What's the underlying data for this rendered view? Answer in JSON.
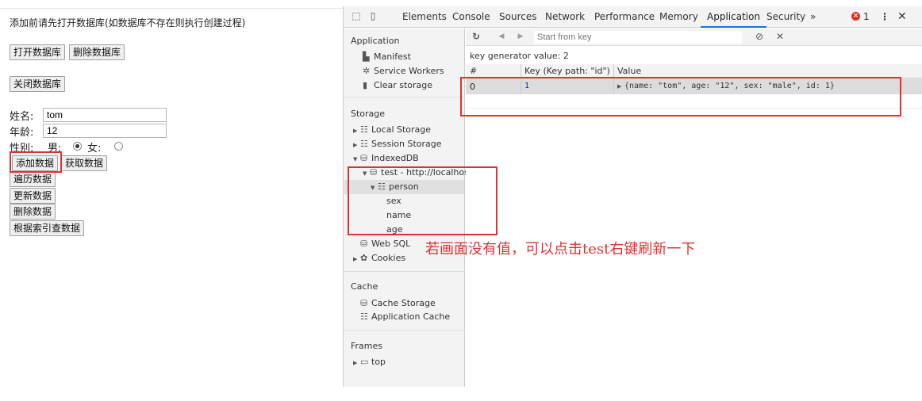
{
  "page": {
    "intro": "添加前请先打开数据库(如数据库不存在则执行创建过程)",
    "buttons": {
      "open_db": "打开数据库",
      "delete_db": "删除数据库",
      "close_db": "关闭数据库",
      "add": "添加数据",
      "get": "获取数据",
      "iterate": "遍历数据",
      "update": "更新数据",
      "delete": "删除数据",
      "query_index": "根据索引查数据"
    },
    "form": {
      "name_label": "姓名:",
      "name_value": "tom",
      "age_label": "年龄:",
      "age_value": "12",
      "gender_label": "性别:",
      "male_label": "男:",
      "female_label": "女:",
      "selected_gender": "male"
    }
  },
  "devtools": {
    "tabs": [
      "Elements",
      "Console",
      "Sources",
      "Network",
      "Performance",
      "Memory",
      "Application",
      "Security"
    ],
    "active_tab": "Application",
    "more_tabs": "»",
    "error_count": "1",
    "sidebar": {
      "application_title": "Application",
      "application_items": [
        "Manifest",
        "Service Workers",
        "Clear storage"
      ],
      "storage_title": "Storage",
      "local_storage": "Local Storage",
      "session_storage": "Session Storage",
      "indexeddb": "IndexedDB",
      "db_name": "test - http://localhost",
      "store_name": "person",
      "indexes": [
        "sex",
        "name",
        "age"
      ],
      "web_sql": "Web SQL",
      "cookies": "Cookies",
      "cache_title": "Cache",
      "cache_storage": "Cache Storage",
      "application_cache": "Application Cache",
      "frames_title": "Frames",
      "frame_top": "top"
    },
    "main": {
      "key_placeholder": "Start from key",
      "key_generator": "key generator value: 2",
      "columns": [
        "#",
        "Key (Key path: \"id\")",
        "Value"
      ],
      "row": {
        "index": "0",
        "key": "1",
        "value": "{name: \"tom\", age: \"12\", sex: \"male\", id: 1}"
      }
    }
  },
  "annotation": "若画面没有值，可以点击test右键刷新一下",
  "colors": {
    "annotation_red": "#e03131",
    "active_tab": "#1a73e8"
  }
}
